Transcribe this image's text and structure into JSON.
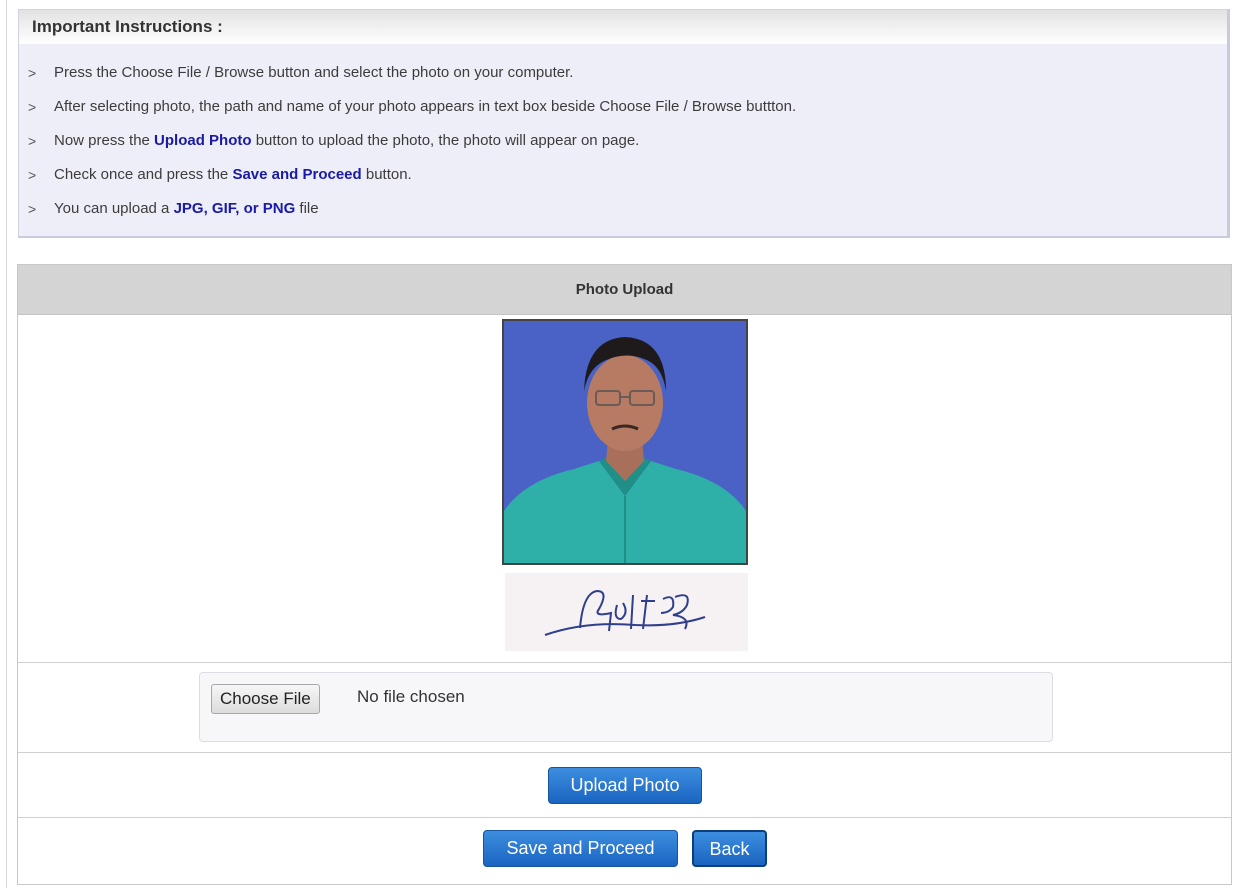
{
  "instructions": {
    "title": "Important Instructions :",
    "items": [
      {
        "bullet": ">",
        "pre": "Press the Choose File / Browse button and select the photo on your computer.",
        "highlight": "",
        "post": ""
      },
      {
        "bullet": ">",
        "pre": "After selecting photo, the path and name of your photo appears in text box beside Choose File / Browse buttton.",
        "highlight": "",
        "post": ""
      },
      {
        "bullet": ">",
        "pre": "Now press the ",
        "highlight": "Upload Photo",
        "post": " button to upload the photo, the photo will appear on page."
      },
      {
        "bullet": ">",
        "pre": "Check once and press the ",
        "highlight": "Save and Proceed",
        "post": " button."
      },
      {
        "bullet": ">",
        "pre": "You can upload a ",
        "highlight": "JPG, GIF, or PNG",
        "post": " file"
      }
    ]
  },
  "upload": {
    "header": "Photo Upload",
    "photo_alt": "uploaded candidate photo",
    "signature_alt": "candidate signature",
    "choose_file_label": "Choose File",
    "file_status": "No file chosen",
    "upload_button": "Upload Photo",
    "save_button": "Save and Proceed",
    "back_button": "Back"
  },
  "colors": {
    "highlight": "#1a1aa6",
    "button_blue": "#1a64c0",
    "instructions_bg": "#eeeef8",
    "panel_header_bg": "#d4d4d4"
  }
}
